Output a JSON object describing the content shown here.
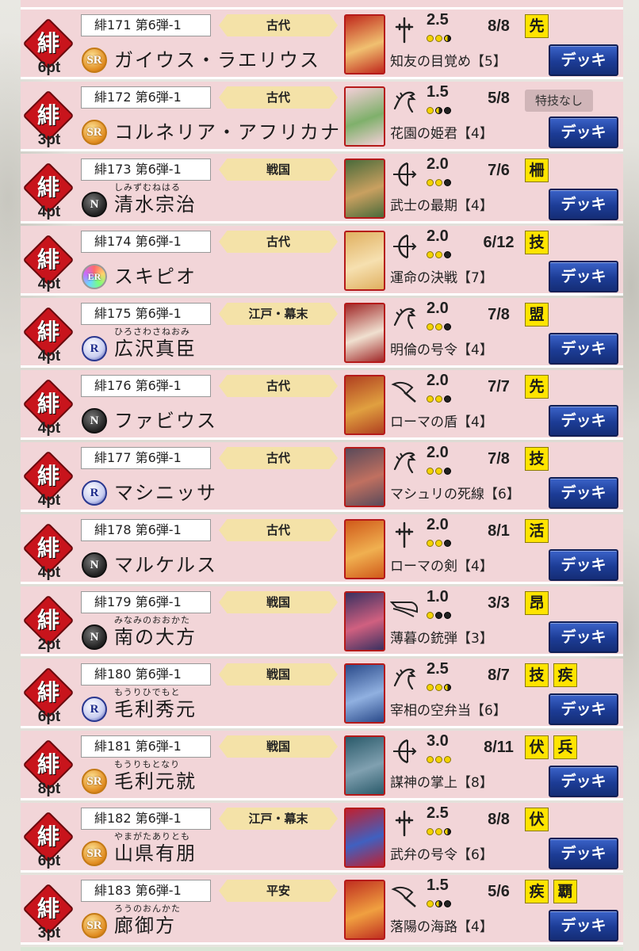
{
  "colors": {
    "row_bg": "#f2d5d8",
    "tag_yellow": "#ffe400",
    "era_gold": "#f4e2a8",
    "button_blue": "#1c3c95",
    "badge_red": "#c8141c"
  },
  "badge_char": "緋",
  "deck_label": "デッキ",
  "cards": [
    {
      "pts": "6pt",
      "code": "緋171 第6弾-1",
      "era": "古代",
      "rarity": "SR",
      "ruby": "",
      "name": "ガイウス・ラエリウス",
      "weapon": "spear-icon",
      "cost": "2.5",
      "cost_dots": [
        1,
        1,
        0.5
      ],
      "stats": "8/8",
      "tags": [
        "先"
      ],
      "skill": "知友の目覚め【5】",
      "art": [
        "#c0281c",
        "#f0c070"
      ]
    },
    {
      "pts": "3pt",
      "code": "緋172 第6弾-1",
      "era": "古代",
      "rarity": "SR",
      "ruby": "",
      "name": "コルネリア・アフリカナ",
      "weapon": "horse-icon",
      "cost": "1.5",
      "cost_dots": [
        1,
        0.5,
        0
      ],
      "stats": "5/8",
      "tags": [],
      "notag": "特技なし",
      "skill": "花園の姫君【4】",
      "art": [
        "#f4cfd8",
        "#7fb06b"
      ]
    },
    {
      "pts": "4pt",
      "code": "緋173 第6弾-1",
      "era": "戦国",
      "rarity": "N",
      "ruby": "しみずむねはる",
      "name": "清水宗治",
      "weapon": "bow-icon",
      "cost": "2.0",
      "cost_dots": [
        1,
        1,
        0
      ],
      "stats": "7/6",
      "tags": [
        "柵"
      ],
      "skill": "武士の最期【4】",
      "art": [
        "#4a6a3a",
        "#c9a060"
      ]
    },
    {
      "pts": "4pt",
      "code": "緋174 第6弾-1",
      "era": "古代",
      "rarity": "ER",
      "ruby": "",
      "name": "スキピオ",
      "weapon": "bow-icon",
      "cost": "2.0",
      "cost_dots": [
        1,
        1,
        0
      ],
      "stats": "6/12",
      "tags": [
        "技"
      ],
      "skill": "運命の決戦【7】",
      "art": [
        "#e0b060",
        "#f6e0b0"
      ]
    },
    {
      "pts": "4pt",
      "code": "緋175 第6弾-1",
      "era": "江戸・幕末",
      "rarity": "R",
      "ruby": "ひろさわさねおみ",
      "name": "広沢真臣",
      "weapon": "horse-icon",
      "cost": "2.0",
      "cost_dots": [
        1,
        1,
        0
      ],
      "stats": "7/8",
      "tags": [
        "盟"
      ],
      "skill": "明倫の号令【4】",
      "art": [
        "#a02828",
        "#f0e0d0"
      ]
    },
    {
      "pts": "4pt",
      "code": "緋176 第6弾-1",
      "era": "古代",
      "rarity": "N",
      "ruby": "",
      "name": "ファビウス",
      "weapon": "axe-icon",
      "cost": "2.0",
      "cost_dots": [
        1,
        1,
        0
      ],
      "stats": "7/7",
      "tags": [
        "先"
      ],
      "skill": "ローマの盾【4】",
      "art": [
        "#b04020",
        "#e0a040"
      ]
    },
    {
      "pts": "4pt",
      "code": "緋177 第6弾-1",
      "era": "古代",
      "rarity": "R",
      "ruby": "",
      "name": "マシニッサ",
      "weapon": "horse-icon",
      "cost": "2.0",
      "cost_dots": [
        1,
        1,
        0
      ],
      "stats": "7/8",
      "tags": [
        "技"
      ],
      "skill": "マシュリの死線【6】",
      "art": [
        "#5a4a5a",
        "#c07060"
      ]
    },
    {
      "pts": "4pt",
      "code": "緋178 第6弾-1",
      "era": "古代",
      "rarity": "N",
      "ruby": "",
      "name": "マルケルス",
      "weapon": "spear-icon",
      "cost": "2.0",
      "cost_dots": [
        1,
        1,
        0
      ],
      "stats": "8/1",
      "tags": [
        "活"
      ],
      "skill": "ローマの剣【4】",
      "art": [
        "#d05a1a",
        "#f0b050"
      ]
    },
    {
      "pts": "2pt",
      "code": "緋179 第6弾-1",
      "era": "戦国",
      "rarity": "N",
      "ruby": "みなみのおおかた",
      "name": "南の大方",
      "weapon": "gun-icon",
      "cost": "1.0",
      "cost_dots": [
        1,
        0,
        0
      ],
      "stats": "3/3",
      "tags": [
        "昂"
      ],
      "skill": "薄暮の銃弾【3】",
      "art": [
        "#3a3060",
        "#d06080"
      ]
    },
    {
      "pts": "6pt",
      "code": "緋180 第6弾-1",
      "era": "戦国",
      "rarity": "R",
      "ruby": "もうりひでもと",
      "name": "毛利秀元",
      "weapon": "horse-icon",
      "cost": "2.5",
      "cost_dots": [
        1,
        1,
        0.5
      ],
      "stats": "8/7",
      "tags": [
        "技",
        "疾"
      ],
      "skill": "宰相の空弁当【6】",
      "art": [
        "#2a4a8a",
        "#90b0e0"
      ]
    },
    {
      "pts": "8pt",
      "code": "緋181 第6弾-1",
      "era": "戦国",
      "rarity": "SR",
      "ruby": "もうりもとなり",
      "name": "毛利元就",
      "weapon": "bow-icon",
      "cost": "3.0",
      "cost_dots": [
        1,
        1,
        1
      ],
      "stats": "8/11",
      "tags": [
        "伏",
        "兵"
      ],
      "skill": "謀神の掌上【8】",
      "art": [
        "#2a5a6a",
        "#80a0b0"
      ]
    },
    {
      "pts": "6pt",
      "code": "緋182 第6弾-1",
      "era": "江戸・幕末",
      "rarity": "SR",
      "ruby": "やまがたありとも",
      "name": "山県有朋",
      "weapon": "spear-icon",
      "cost": "2.5",
      "cost_dots": [
        1,
        1,
        0.5
      ],
      "stats": "8/8",
      "tags": [
        "伏"
      ],
      "skill": "武弁の号令【6】",
      "art": [
        "#c02030",
        "#4060c0"
      ]
    },
    {
      "pts": "3pt",
      "code": "緋183 第6弾-1",
      "era": "平安",
      "rarity": "SR",
      "ruby": "ろうのおんかた",
      "name": "廊御方",
      "weapon": "axe-icon",
      "cost": "1.5",
      "cost_dots": [
        1,
        0.5,
        0
      ],
      "stats": "5/6",
      "tags": [
        "疾",
        "覇"
      ],
      "skill": "落陽の海路【4】",
      "art": [
        "#c03020",
        "#f0a040"
      ]
    }
  ]
}
